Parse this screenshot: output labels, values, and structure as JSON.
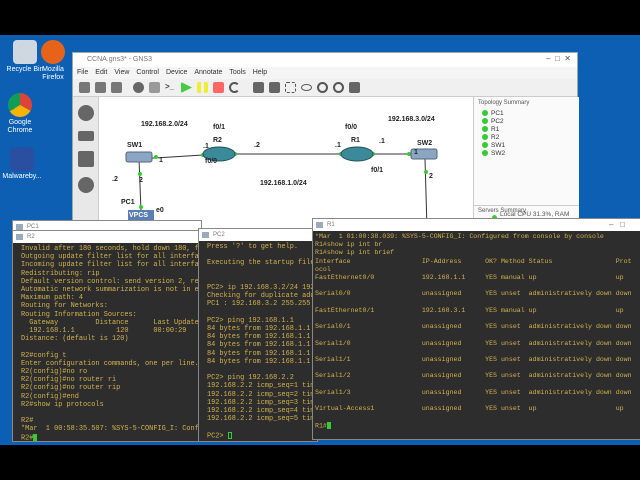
{
  "desktop": {
    "icons": [
      {
        "label": "Recycle Bin"
      },
      {
        "label": "Mozilla Firefox"
      },
      {
        "label": "Google Chrome"
      },
      {
        "label": "Malwareby..."
      }
    ]
  },
  "gns3": {
    "title": "CCNA.gns3* - GNS3",
    "menu": [
      "File",
      "Edit",
      "View",
      "Control",
      "Device",
      "Annotate",
      "Tools",
      "Help"
    ],
    "topology": {
      "nodes": [
        "SW1",
        "R2",
        "R1",
        "SW2",
        "PC1"
      ],
      "labels": {
        "net2": "192.168.2.0/24",
        "net1": "192.168.1.0/24",
        "net3": "192.168.3.0/24",
        "r2_f01": "f0/1",
        "r2_f00": "f0/0",
        "r2_dot1": ".1",
        "r2_dot2": ".2",
        "r1_f00": "f0/0",
        "r1_dot1a": ".1",
        "r1_dot1b": ".1",
        "r1_f01": "f0/1",
        "sw1_p1": "1",
        "sw1_p2": "2",
        "sw2_p1": "1",
        "sw2_p2": "2",
        "pc1_dot2": ".2",
        "pc1_e0": "e0",
        "vpcs": "VPCS"
      }
    },
    "summary": {
      "title": "Topology Summary",
      "items": [
        "PC1",
        "PC2",
        "R1",
        "R2",
        "SW1",
        "SW2"
      ]
    },
    "servers": {
      "title": "Servers Summary",
      "local": "Local CPU 31.3%, RAM 52.1%"
    }
  },
  "windows": {
    "pc1": {
      "title": "PC1"
    },
    "r2": {
      "title": "R2",
      "text": "Invalid after 180 seconds, hold down 180, fl\nOutgoing update filter list for all interfac\nIncoming update filter list for all interfac\nRedistributing: rip\nDefault version control: send version 2, rec\nAutomatic network summarization is not in ef\nMaximum path: 4\nRouting for Networks:\nRouting Information Sources:\n  Gateway         Distance      Last Update\n  192.168.1.1          120      00:00:29\nDistance: (default is 120)\n\nR2#config t\nEnter configuration commands, one per line.  E\nR2(config)#no ro\nR2(config)#no router ri\nR2(config)#no router rip\nR2(config)#end\nR2#show ip protocols\n\nR2#\n*Mar  1 00:58:35.507: %SYS-5-CONFIG_I: Configu",
      "prompt": "R2#"
    },
    "pc2": {
      "title": "PC2",
      "text": "Press '?' to get help.\n\nExecuting the startup file\n\n\nPC2> ip 192.168.3.2/24 192.1\nChecking for duplicate addre\nPC1 : 192.168.3.2 255.255.25\n\nPC2> ping 192.168.1.1\n84 bytes from 192.168.1.1 ic\n84 bytes from 192.168.1.1 ic\n84 bytes from 192.168.1.1 ic\n84 bytes from 192.168.1.1 ic\n84 bytes from 192.168.1.1 ic\n\nPC2> ping 192.168.2.2\n192.168.2.2 icmp_seq=1 timed\n192.168.2.2 icmp_seq=2 timed\n192.168.2.2 icmp_seq=3 timed\n192.168.2.2 icmp_seq=4 timed\n192.168.2.2 icmp_seq=5 timed\n",
      "prompt": "PC2> "
    },
    "r1": {
      "title": "R1",
      "text": "*Mar  1 01:00:38.039: %SYS-5-CONFIG_I: Configured from console by console\nR1#show ip int br\nR1#show ip int brief\nInterface                  IP-Address      OK? Method Status                Prot\nocol\nFastEthernet0/0            192.168.1.1     YES manual up                    up\n\nSerial0/0                  unassigned      YES unset  administratively down down\n\nFastEthernet0/1            192.168.3.1     YES manual up                    up\n\nSerial0/1                  unassigned      YES unset  administratively down down\n\nSerial1/0                  unassigned      YES unset  administratively down down\n\nSerial1/1                  unassigned      YES unset  administratively down down\n\nSerial1/2                  unassigned      YES unset  administratively down down\n\nSerial1/3                  unassigned      YES unset  administratively down down\n\nVirtual-Access1            unassigned      YES unset  up                    up\n\n",
      "prompt": "R1#"
    }
  },
  "colors": {
    "desktop": "#0d5fb4",
    "terminal_bg": "#2d2d2d",
    "terminal_text": "#d4b24c",
    "link_dot": "#33cc33"
  }
}
